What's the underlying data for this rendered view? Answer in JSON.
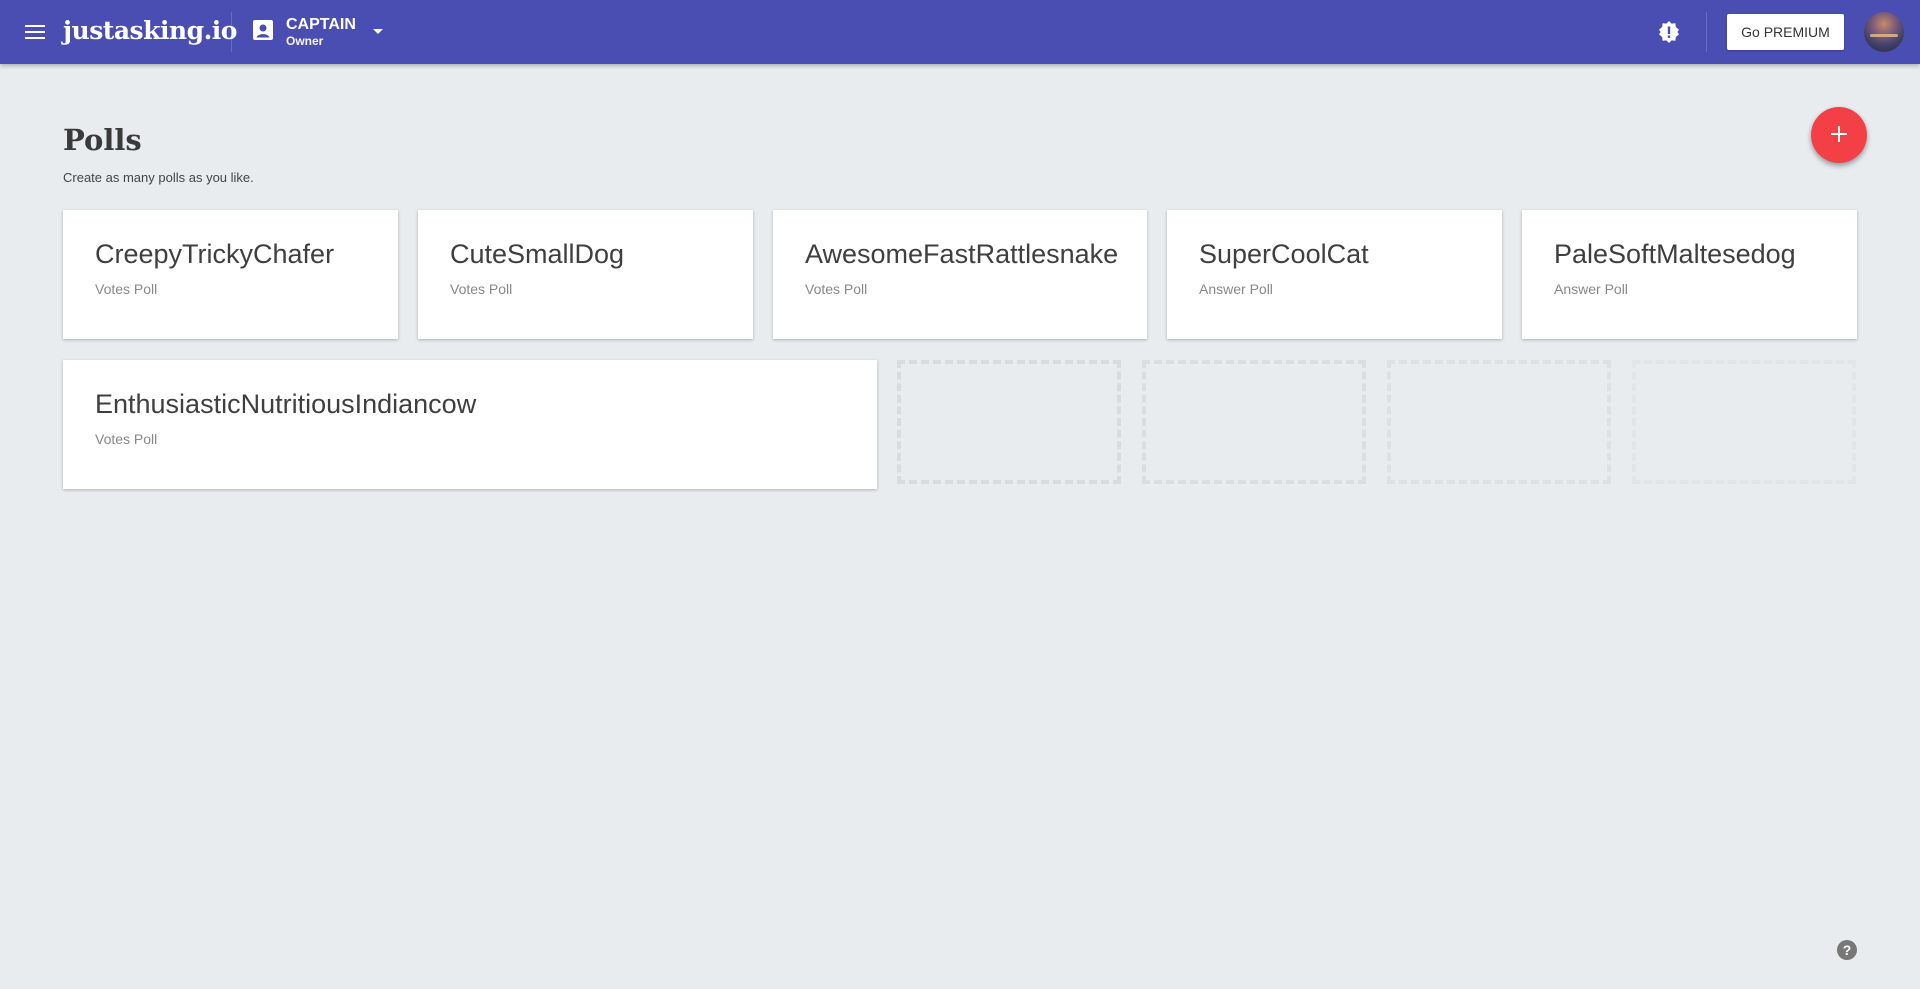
{
  "header": {
    "logo": "justasking.io",
    "event": {
      "name": "CAPTAIN",
      "role": "Owner"
    },
    "premium_label": "Go PREMIUM",
    "icons": {
      "menu": "menu-icon",
      "event": "account-box-icon",
      "caret": "caret-down-icon",
      "notice": "alert-badge-icon"
    }
  },
  "main": {
    "title": "Polls",
    "subtitle": "Create as many polls as you like.",
    "fab_icon": "plus-icon",
    "polls": [
      {
        "name": "CreepyTrickyChafer",
        "type": "Votes Poll"
      },
      {
        "name": "CuteSmallDog",
        "type": "Votes Poll"
      },
      {
        "name": "AwesomeFastRattlesnake",
        "type": "Votes Poll"
      },
      {
        "name": "SuperCoolCat",
        "type": "Answer Poll"
      },
      {
        "name": "PaleSoftMaltesedog",
        "type": "Answer Poll"
      },
      {
        "name": "EnthusiasticNutritiousIndiancow",
        "type": "Votes Poll"
      }
    ]
  },
  "footer": {
    "help_label": "?"
  },
  "colors": {
    "header_bg": "#4a4db1",
    "page_bg": "#e9ecef",
    "fab": "#f33f46",
    "card_bg": "#ffffff"
  }
}
